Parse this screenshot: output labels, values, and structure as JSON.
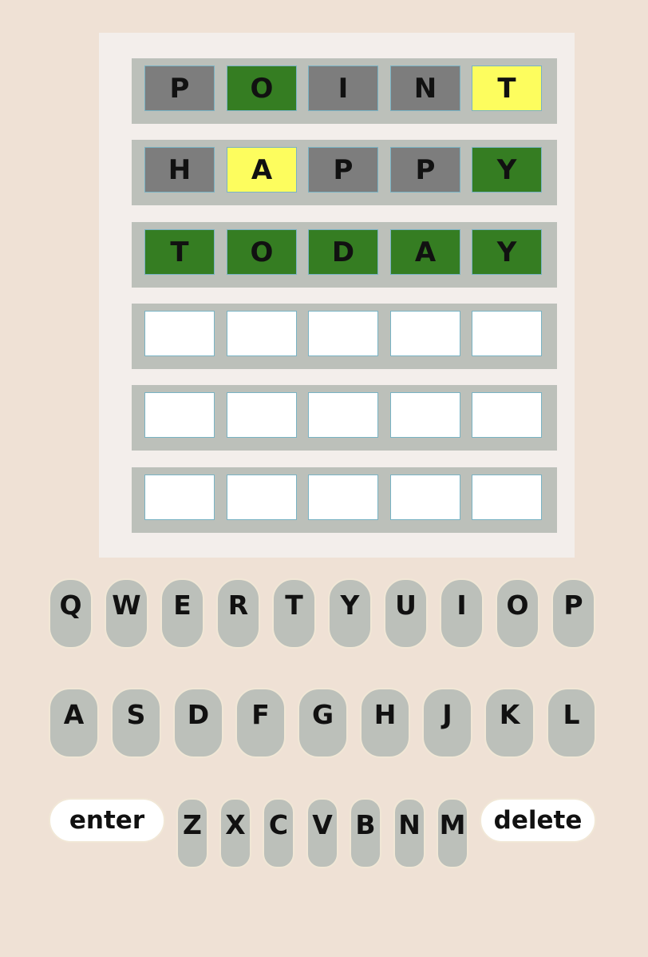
{
  "board": {
    "rows": [
      {
        "tiles": [
          {
            "letter": "P",
            "state": "absent"
          },
          {
            "letter": "O",
            "state": "correct"
          },
          {
            "letter": "I",
            "state": "absent"
          },
          {
            "letter": "N",
            "state": "absent"
          },
          {
            "letter": "T",
            "state": "present"
          }
        ]
      },
      {
        "tiles": [
          {
            "letter": "H",
            "state": "absent"
          },
          {
            "letter": "A",
            "state": "present"
          },
          {
            "letter": "P",
            "state": "absent"
          },
          {
            "letter": "P",
            "state": "absent"
          },
          {
            "letter": "Y",
            "state": "correct"
          }
        ]
      },
      {
        "tiles": [
          {
            "letter": "T",
            "state": "correct"
          },
          {
            "letter": "O",
            "state": "correct"
          },
          {
            "letter": "D",
            "state": "correct"
          },
          {
            "letter": "A",
            "state": "correct"
          },
          {
            "letter": "Y",
            "state": "correct"
          }
        ]
      },
      {
        "tiles": [
          {
            "letter": "",
            "state": "empty"
          },
          {
            "letter": "",
            "state": "empty"
          },
          {
            "letter": "",
            "state": "empty"
          },
          {
            "letter": "",
            "state": "empty"
          },
          {
            "letter": "",
            "state": "empty"
          }
        ]
      },
      {
        "tiles": [
          {
            "letter": "",
            "state": "empty"
          },
          {
            "letter": "",
            "state": "empty"
          },
          {
            "letter": "",
            "state": "empty"
          },
          {
            "letter": "",
            "state": "empty"
          },
          {
            "letter": "",
            "state": "empty"
          }
        ]
      },
      {
        "tiles": [
          {
            "letter": "",
            "state": "empty"
          },
          {
            "letter": "",
            "state": "empty"
          },
          {
            "letter": "",
            "state": "empty"
          },
          {
            "letter": "",
            "state": "empty"
          },
          {
            "letter": "",
            "state": "empty"
          }
        ]
      }
    ]
  },
  "keyboard": {
    "row1": [
      "Q",
      "W",
      "E",
      "R",
      "T",
      "Y",
      "U",
      "I",
      "O",
      "P"
    ],
    "row2": [
      "A",
      "S",
      "D",
      "F",
      "G",
      "H",
      "J",
      "K",
      "L"
    ],
    "row3": [
      "Z",
      "X",
      "C",
      "V",
      "B",
      "N",
      "M"
    ],
    "enter_label": "enter",
    "delete_label": "delete"
  },
  "colors": {
    "background": "#efe1d5",
    "correct": "#357d22",
    "present": "#fdfd5e",
    "absent": "#7d7d7d",
    "empty": "#ffffff",
    "key": "#bcc0ba"
  }
}
